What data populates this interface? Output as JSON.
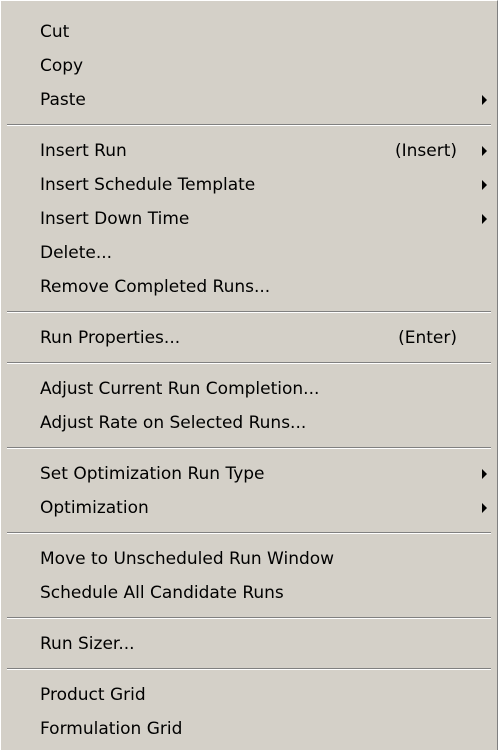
{
  "menu": {
    "groups": [
      {
        "items": [
          {
            "label": "Cut",
            "shortcut": "",
            "submenu": false
          },
          {
            "label": "Copy",
            "shortcut": "",
            "submenu": false
          },
          {
            "label": "Paste",
            "shortcut": "",
            "submenu": true
          }
        ]
      },
      {
        "items": [
          {
            "label": "Insert Run",
            "shortcut": "(Insert)",
            "submenu": true
          },
          {
            "label": "Insert Schedule Template",
            "shortcut": "",
            "submenu": true
          },
          {
            "label": "Insert Down Time",
            "shortcut": "",
            "submenu": true
          },
          {
            "label": "Delete...",
            "shortcut": "",
            "submenu": false
          },
          {
            "label": "Remove Completed Runs...",
            "shortcut": "",
            "submenu": false
          }
        ]
      },
      {
        "items": [
          {
            "label": "Run Properties...",
            "shortcut": "(Enter)",
            "submenu": false
          }
        ]
      },
      {
        "items": [
          {
            "label": "Adjust Current Run Completion...",
            "shortcut": "",
            "submenu": false
          },
          {
            "label": "Adjust Rate on Selected Runs...",
            "shortcut": "",
            "submenu": false
          }
        ]
      },
      {
        "items": [
          {
            "label": "Set Optimization Run Type",
            "shortcut": "",
            "submenu": true
          },
          {
            "label": "Optimization",
            "shortcut": "",
            "submenu": true
          }
        ]
      },
      {
        "items": [
          {
            "label": "Move to Unscheduled Run Window",
            "shortcut": "",
            "submenu": false
          },
          {
            "label": "Schedule All Candidate Runs",
            "shortcut": "",
            "submenu": false
          }
        ]
      },
      {
        "items": [
          {
            "label": "Run Sizer...",
            "shortcut": "",
            "submenu": false
          }
        ]
      },
      {
        "items": [
          {
            "label": "Product Grid",
            "shortcut": "",
            "submenu": false
          },
          {
            "label": "Formulation Grid",
            "shortcut": "",
            "submenu": false
          }
        ]
      }
    ],
    "colors": {
      "background": "#d4d0c8",
      "text": "#000000",
      "separator_dark": "#808080",
      "separator_light": "#ffffff"
    },
    "icons": {
      "submenu": "submenu-arrow-icon"
    }
  }
}
